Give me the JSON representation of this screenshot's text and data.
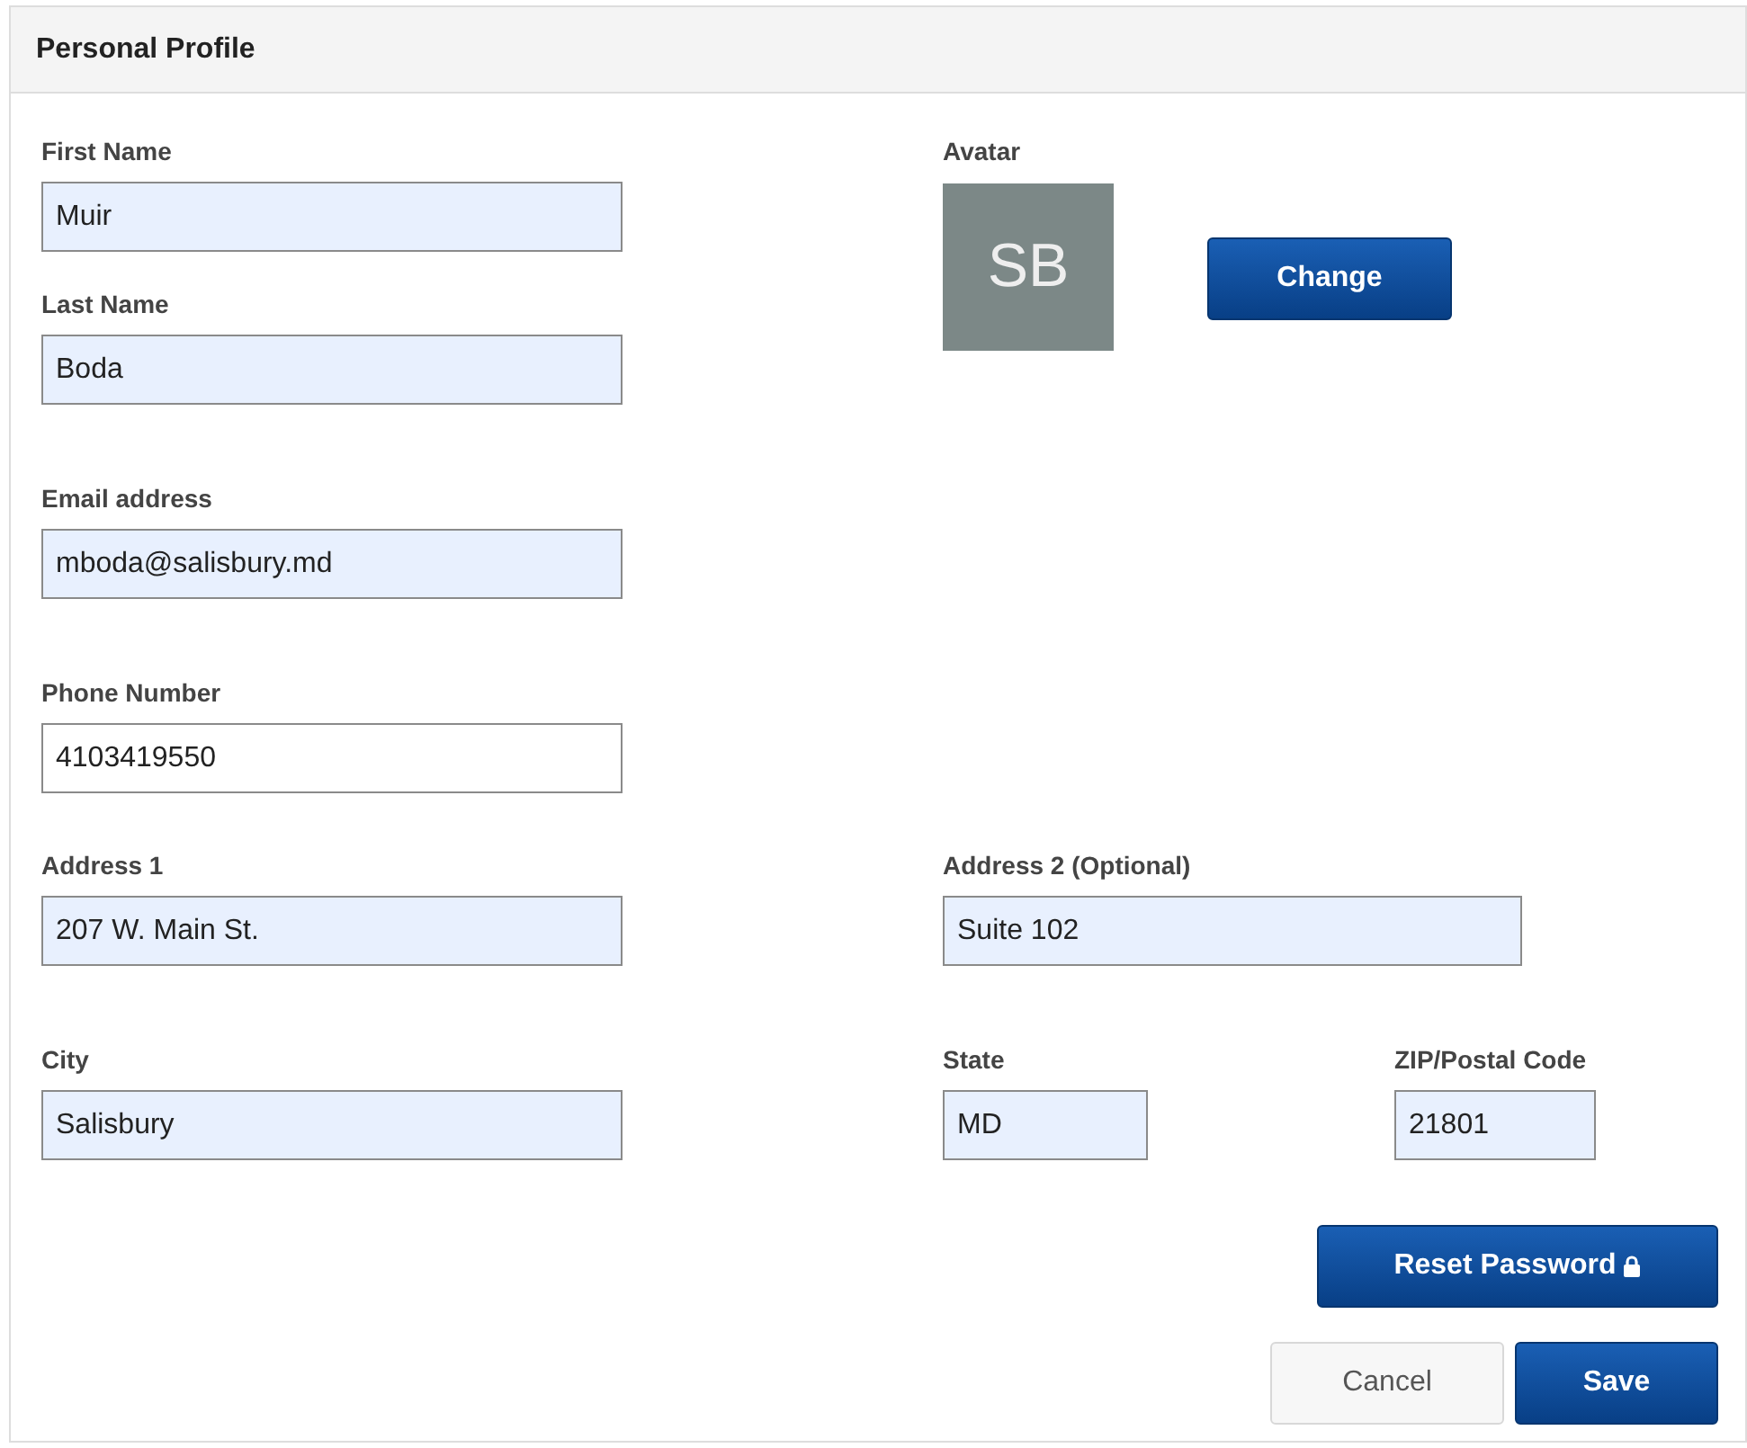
{
  "panel": {
    "title": "Personal Profile"
  },
  "first_name": {
    "label": "First Name",
    "value": "Muir",
    "autofilled": true
  },
  "last_name": {
    "label": "Last Name",
    "value": "Boda",
    "autofilled": true
  },
  "email": {
    "label": "Email address",
    "value": "mboda@salisbury.md",
    "autofilled": true
  },
  "phone": {
    "label": "Phone Number",
    "value": "4103419550",
    "autofilled": false
  },
  "avatar": {
    "label": "Avatar",
    "initials": "SB",
    "button": "Change"
  },
  "address_1": {
    "label": "Address 1",
    "value": "207 W. Main St.",
    "autofilled": true
  },
  "address_2": {
    "label": "Address 2 (Optional)",
    "value": "Suite 102",
    "autofilled": true
  },
  "city": {
    "label": "City",
    "value": "Salisbury",
    "autofilled": true
  },
  "state": {
    "label": "State",
    "value": "MD",
    "autofilled": true
  },
  "zip": {
    "label": "ZIP/Postal Code",
    "value": "21801",
    "autofilled": true
  },
  "buttons": {
    "reset_password": "Reset Password",
    "cancel": "Cancel",
    "save": "Save"
  }
}
